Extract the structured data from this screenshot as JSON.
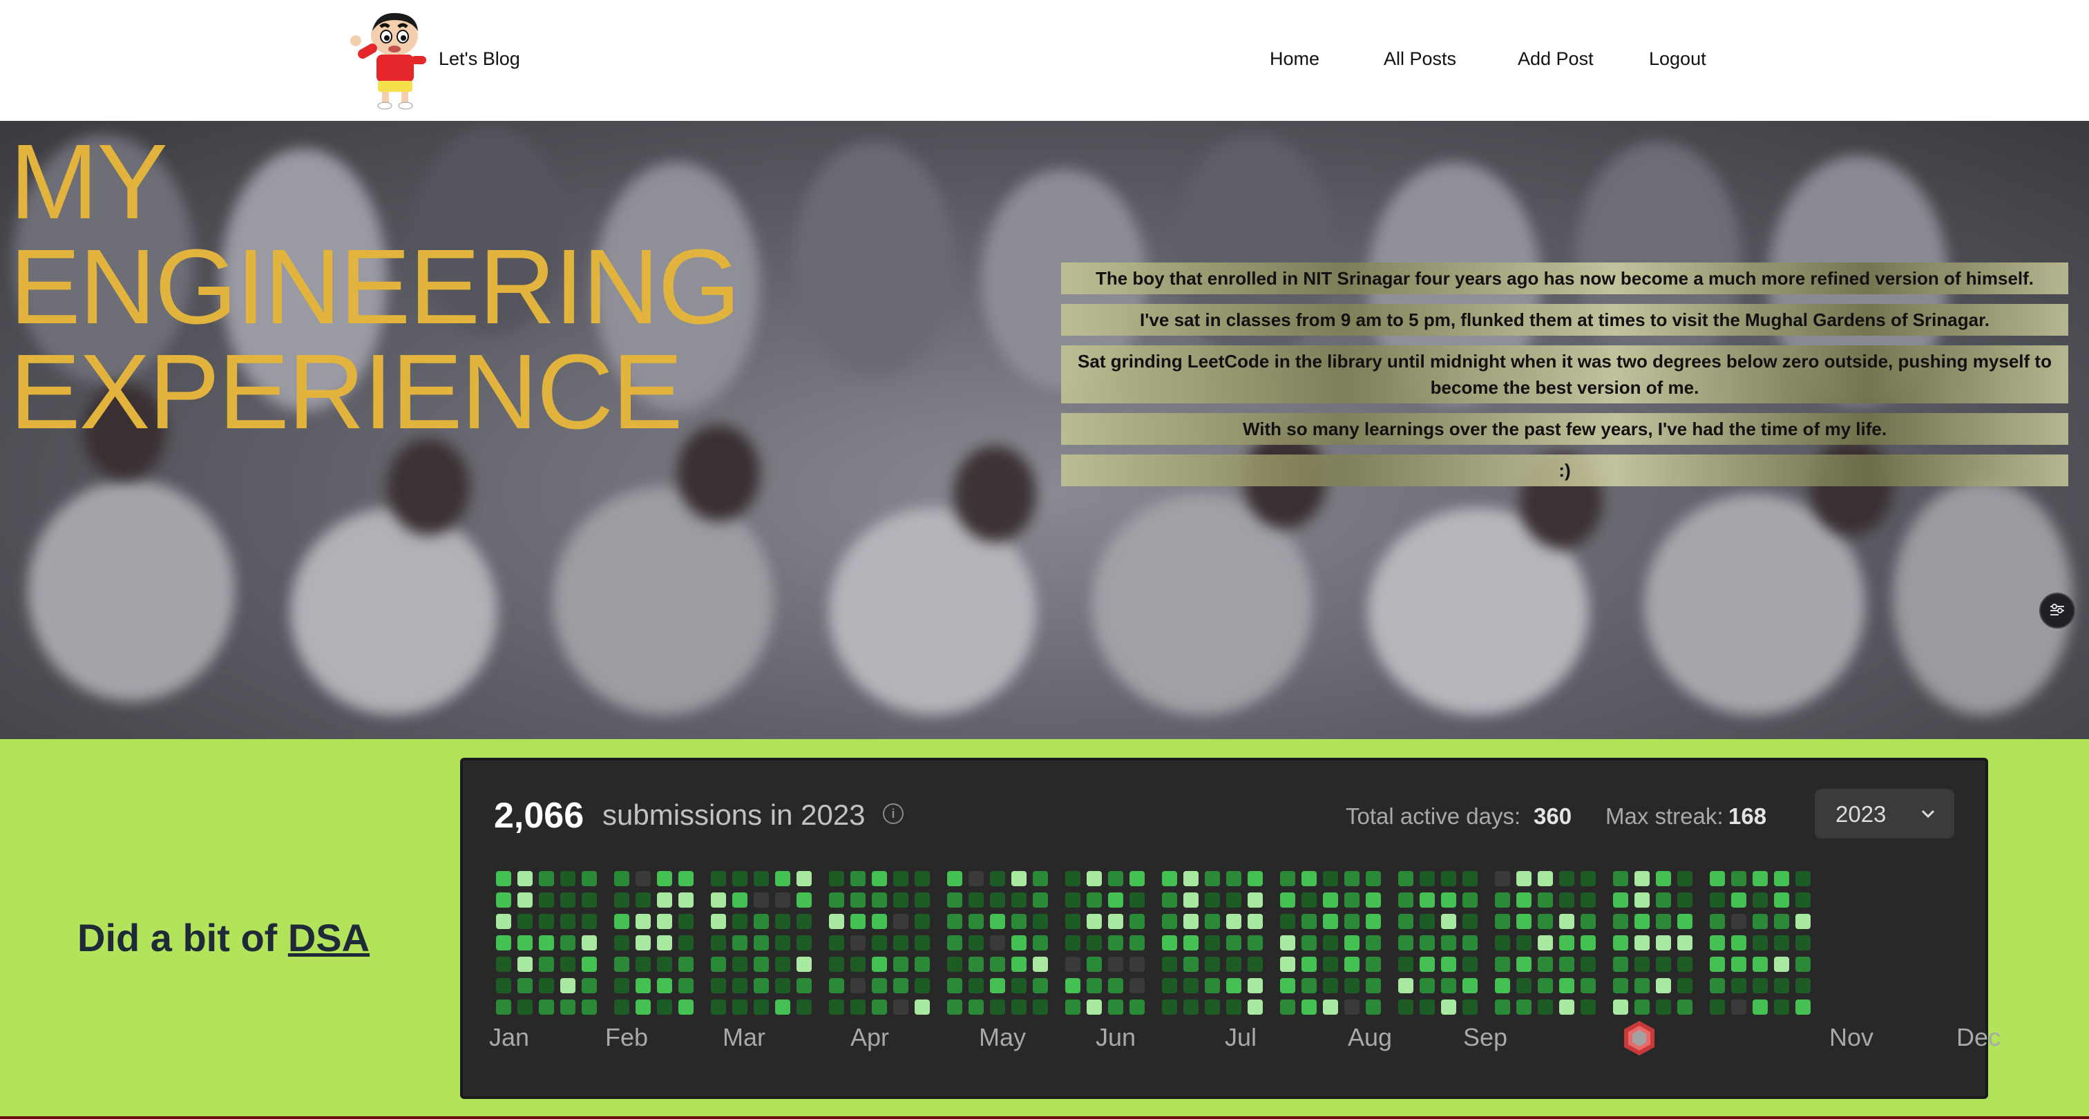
{
  "header": {
    "brand": "Let's Blog",
    "nav": [
      "Home",
      "All Posts",
      "Add Post",
      "Logout"
    ]
  },
  "hero": {
    "title_lines": [
      "MY",
      "ENGINEERING",
      "EXPERIENCE"
    ],
    "story_lines": [
      "The boy that enrolled in NIT Srinagar four years ago has now become a much more refined version of himself.",
      "I've sat in classes from 9 am to 5 pm, flunked them at times to visit the Mughal Gardens of Srinagar.",
      "Sat grinding LeetCode in the library until midnight when it was two degrees below zero outside, pushing myself to become the best version of me.",
      "With so many learnings over the past few years, I've had the time of my life.",
      ":)"
    ],
    "title_color": "#e2b33d",
    "side_button_icon": "sliders-icon"
  },
  "dsa": {
    "prefix": "Did a bit of ",
    "link": "DSA"
  },
  "leetcode": {
    "count": "2,066",
    "count_label": "submissions in 2023",
    "active_days_label": "Total active days:",
    "active_days": "360",
    "max_streak_label": "Max streak:",
    "max_streak": "168",
    "year": "2023",
    "months": [
      "Jan",
      "Feb",
      "Mar",
      "Apr",
      "May",
      "Jun",
      "Jul",
      "Aug",
      "Sep",
      "",
      "Nov",
      "Dec"
    ],
    "october_icon": "leetcode-badge-icon",
    "colors": {
      "card_bg": "#282828",
      "levels": [
        "#3a3a3a",
        "#1e5c26",
        "#2b8a38",
        "#45c053",
        "#a9e8a0"
      ]
    }
  },
  "colors": {
    "lower_bg": "#b2e35a",
    "dsa_text": "#1f2a38"
  }
}
